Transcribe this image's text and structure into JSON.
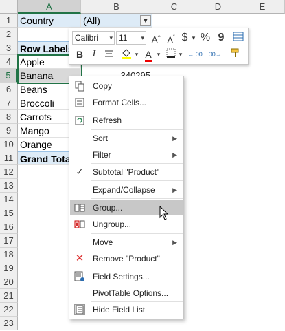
{
  "columns": [
    "A",
    "B",
    "C",
    "D",
    "E"
  ],
  "rows": [
    "1",
    "2",
    "3",
    "4",
    "5",
    "6",
    "7",
    "8",
    "9",
    "10",
    "11",
    "12",
    "13",
    "14",
    "15",
    "16",
    "17",
    "18",
    "19",
    "20",
    "21",
    "22",
    "23"
  ],
  "pivot": {
    "filter_label": "Country",
    "filter_value": "(All)",
    "row_labels_header": "Row Labels",
    "items": [
      "Apple",
      "Banana",
      "Beans",
      "Broccoli",
      "Carrots",
      "Mango",
      "Orange"
    ],
    "grand_total": "Grand Total",
    "partial_value": "340295"
  },
  "mini_toolbar": {
    "font_name": "Calibri",
    "font_size": "11",
    "grow_font": "A",
    "shrink_font": "A",
    "currency": "$",
    "percent": "%",
    "comma": "9",
    "bold": "B",
    "italic": "I",
    "font_color_letter": "A",
    "dec_increase": ".00",
    "dec_decrease": ".00"
  },
  "context_menu": {
    "copy": "Copy",
    "format_cells": "Format Cells...",
    "refresh": "Refresh",
    "sort": "Sort",
    "filter": "Filter",
    "subtotal": "Subtotal \"Product\"",
    "expand_collapse": "Expand/Collapse",
    "group": "Group...",
    "ungroup": "Ungroup...",
    "move": "Move",
    "remove": "Remove \"Product\"",
    "field_settings": "Field Settings...",
    "pivot_options": "PivotTable Options...",
    "hide_field_list": "Hide Field List"
  },
  "colors": {
    "excel_green": "#217346",
    "header_blue": "#ddebf7",
    "highlight": "#c8c8c8"
  }
}
